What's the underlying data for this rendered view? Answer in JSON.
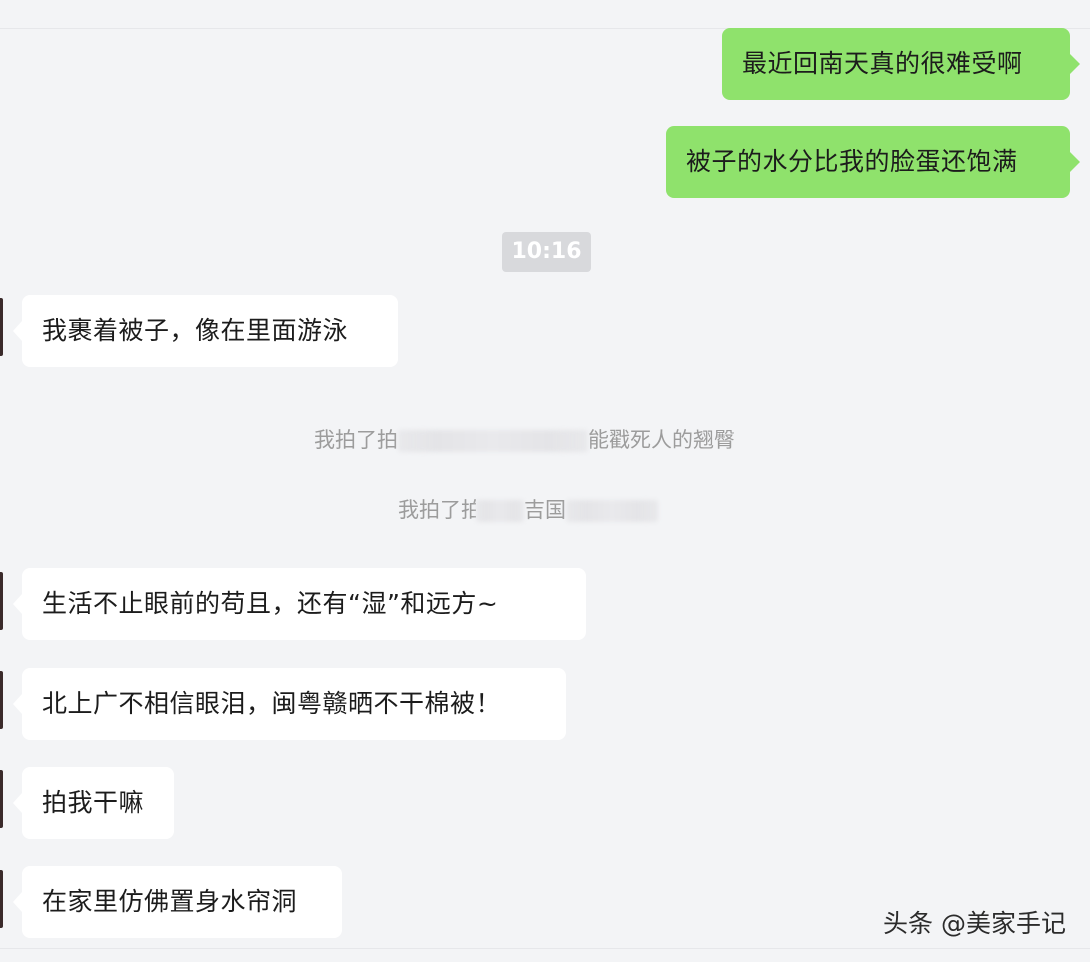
{
  "chat": {
    "sent_messages": [
      "最近回南天真的很难受啊",
      "被子的水分比我的脸蛋还饱满"
    ],
    "timestamp": "10:16",
    "received_messages": [
      "我裹着被子，像在里面游泳",
      "生活不止眼前的苟且，还有“湿”和远方~",
      "北上广不相信眼泪，闽粤赣晒不干棉被！",
      "拍我干嘛",
      "在家里仿佛置身水帘洞"
    ],
    "system_notes": [
      {
        "prefix": "我拍了拍",
        "suffix": "能戳死人的翘臀"
      },
      {
        "prefix": "我拍了拍",
        "middle": "吉国",
        "suffix": ""
      }
    ]
  },
  "watermark": {
    "text": "头条 @美家手记"
  },
  "colors": {
    "background": "#f3f4f6",
    "sent_bubble": "#8fe26c",
    "received_bubble": "#ffffff",
    "system_text": "#9c9c9c"
  }
}
